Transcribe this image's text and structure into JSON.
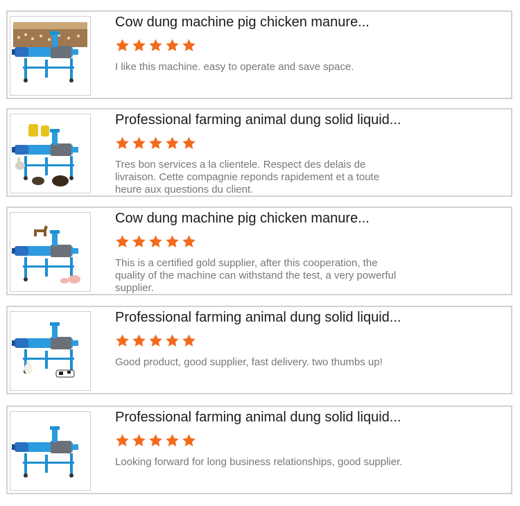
{
  "colors": {
    "star": "#f26b1d",
    "card_border": "#d2d2d2",
    "title_text": "#1a1a1a",
    "review_text": "#777777"
  },
  "reviews": [
    {
      "title": "Cow dung machine pig chicken manure...",
      "rating": 5,
      "review": "I like this machine. easy to operate and save space.",
      "image_icon": "dewatering-machine-chicken-farm-photo"
    },
    {
      "title": "Professional farming animal dung solid liquid...",
      "rating": 5,
      "review": "Tres bon services a la clientele. Respect des delais de livraison. Cette compagnie reponds rapidement et a toute heure aux questions du client.",
      "image_icon": "dewatering-machine-rabbit-photo"
    },
    {
      "title": "Cow dung machine pig chicken manure...",
      "rating": 5,
      "review": "This is a certified gold supplier, after this cooperation, the quality of the machine can withstand the test, a very powerful supplier.",
      "image_icon": "dewatering-machine-horse-pig-photo"
    },
    {
      "title": "Professional farming animal dung solid liquid...",
      "rating": 5,
      "review": "Good product, good supplier, fast delivery. two thumbs up!",
      "image_icon": "dewatering-machine-duck-cow-photo"
    },
    {
      "title": "Professional farming animal dung solid liquid...",
      "rating": 5,
      "review": "Looking forward for long business relationships, good supplier.",
      "image_icon": "dewatering-machine-photo"
    }
  ]
}
